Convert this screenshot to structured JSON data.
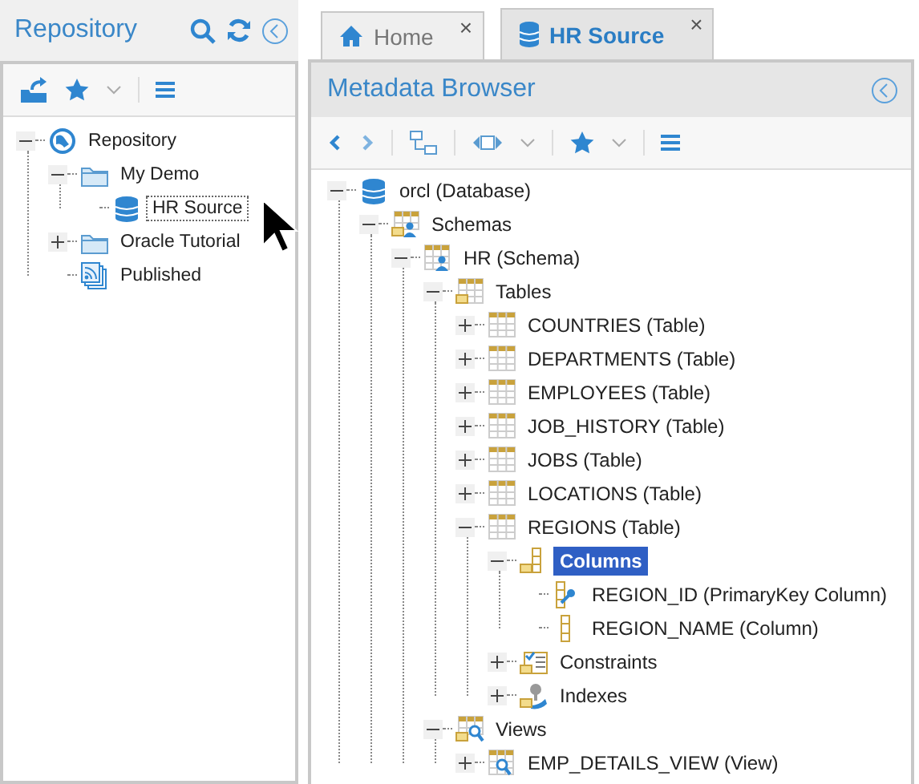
{
  "repository_panel": {
    "title": "Repository",
    "tree": [
      {
        "label": "Repository",
        "kind": "globe",
        "expanded": true,
        "selected": false,
        "children": [
          {
            "label": "My Demo",
            "kind": "folder",
            "expanded": true,
            "selected": false,
            "children": [
              {
                "label": "HR Source",
                "kind": "database",
                "selected": true
              }
            ]
          },
          {
            "label": "Oracle Tutorial",
            "kind": "folder",
            "expanded": false,
            "selected": false
          },
          {
            "label": "Published",
            "kind": "published",
            "selected": false
          }
        ]
      }
    ]
  },
  "tabs": [
    {
      "label": "Home",
      "kind": "home",
      "close": "×",
      "selected": false
    },
    {
      "label": "HR Source",
      "kind": "database",
      "close": "×",
      "selected": true
    }
  ],
  "metadata_browser": {
    "title": "Metadata Browser",
    "tree": [
      {
        "label": "orcl (Database)",
        "kind": "database",
        "expanded": true,
        "selected": false,
        "children": [
          {
            "label": "Schemas",
            "kind": "schemas",
            "expanded": true,
            "selected": false,
            "children": [
              {
                "label": "HR (Schema)",
                "kind": "schema",
                "expanded": true,
                "selected": false,
                "children": [
                  {
                    "label": "Tables",
                    "kind": "tables",
                    "expanded": true,
                    "selected": false,
                    "children": [
                      {
                        "label": "COUNTRIES (Table)",
                        "kind": "table",
                        "expanded": false,
                        "selected": false
                      },
                      {
                        "label": "DEPARTMENTS (Table)",
                        "kind": "table",
                        "expanded": false,
                        "selected": false
                      },
                      {
                        "label": "EMPLOYEES (Table)",
                        "kind": "table",
                        "expanded": false,
                        "selected": false
                      },
                      {
                        "label": "JOB_HISTORY (Table)",
                        "kind": "table",
                        "expanded": false,
                        "selected": false
                      },
                      {
                        "label": "JOBS (Table)",
                        "kind": "table",
                        "expanded": false,
                        "selected": false
                      },
                      {
                        "label": "LOCATIONS (Table)",
                        "kind": "table",
                        "expanded": false,
                        "selected": false
                      },
                      {
                        "label": "REGIONS (Table)",
                        "kind": "table",
                        "expanded": true,
                        "selected": false,
                        "children": [
                          {
                            "label": "Columns",
                            "kind": "columns",
                            "expanded": true,
                            "selected": true,
                            "children": [
                              {
                                "label": "REGION_ID (PrimaryKey Column)",
                                "kind": "pk-column",
                                "selected": false
                              },
                              {
                                "label": "REGION_NAME (Column)",
                                "kind": "column",
                                "selected": false
                              }
                            ]
                          },
                          {
                            "label": "Constraints",
                            "kind": "constraints",
                            "expanded": false,
                            "selected": false
                          },
                          {
                            "label": "Indexes",
                            "kind": "indexes",
                            "expanded": false,
                            "selected": false
                          }
                        ]
                      }
                    ]
                  },
                  {
                    "label": "Views",
                    "kind": "views",
                    "expanded": true,
                    "selected": false,
                    "children": [
                      {
                        "label": "EMP_DETAILS_VIEW (View)",
                        "kind": "view",
                        "expanded": false,
                        "selected": false
                      }
                    ]
                  }
                ]
              }
            ]
          }
        ]
      }
    ]
  }
}
